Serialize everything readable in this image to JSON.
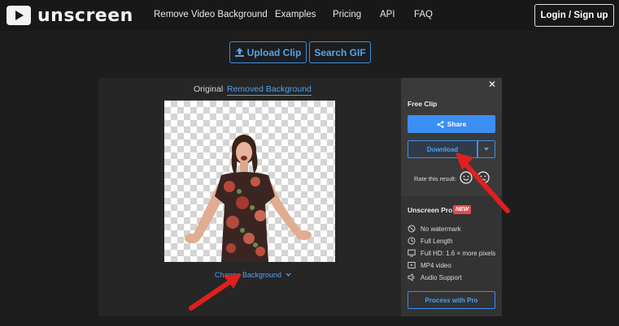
{
  "nav": {
    "brand": "unscreen",
    "links": [
      "Remove Video Background",
      "Examples",
      "Pricing",
      "API",
      "FAQ"
    ],
    "login_label": "Login / Sign up"
  },
  "actions": {
    "upload_label": "Upload Clip",
    "search_label": "Search GIF"
  },
  "preview": {
    "tabs": [
      "Original",
      "Removed Background"
    ],
    "active_tab": "Removed Background",
    "change_background_label": "Change Background"
  },
  "side_panel": {
    "title": "Free Clip",
    "share_label": "Share",
    "download_label": "Download",
    "rate_label": "Rate this result:",
    "pro_title": "Unscreen Pro",
    "new_badge": "NEW",
    "features": [
      {
        "icon": "no-watermark-icon",
        "label": "No watermark"
      },
      {
        "icon": "clock-icon",
        "label": "Full Length"
      },
      {
        "icon": "monitor-icon",
        "label": "Full HD: 1.6 × more pixels"
      },
      {
        "icon": "video-icon",
        "label": "MP4 video"
      },
      {
        "icon": "speaker-icon",
        "label": "Audio Support"
      }
    ],
    "pro_button_label": "Process with Pro"
  },
  "colors": {
    "accent": "#3b8ff2",
    "badge": "#e34b4b",
    "annotation_arrow": "#e01f1f"
  }
}
